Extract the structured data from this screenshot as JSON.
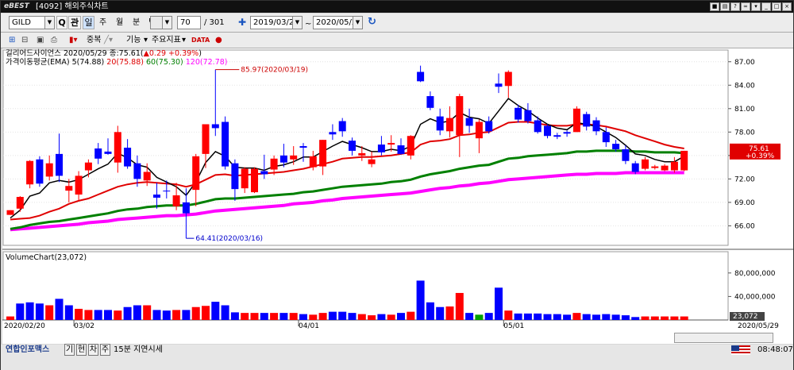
{
  "titlebar": {
    "logo": "eBEST",
    "title": "[4092] 해외주식차트"
  },
  "toolbar": {
    "symbol": "GILD",
    "search_label": "Q",
    "mode_label": "관",
    "periods": [
      "일",
      "주",
      "월",
      "분",
      "틱"
    ],
    "count": "70",
    "total": "/ 301",
    "start_date": "2019/03/21",
    "end_date": "2020/05/29",
    "range_sep": "~"
  },
  "toolbar2": {
    "overlap_label": "중복",
    "function_label": "기능",
    "indicator_label": "주요지표"
  },
  "legend": {
    "name": "길리어드사이언스",
    "info": "2020/05/29 종:75.61(",
    "change": "▲0.29 +0.39%",
    "close_paren": ")",
    "ema_label": "가격이동평균(EMA)",
    "ema5": "5(74.88)",
    "ema20": "20(75.88)",
    "ema60": "60(75.30)",
    "ema120": "120(72.78)",
    "volume_label": "VolumeChart(23,072)"
  },
  "annotations": {
    "high": "85.97(2020/03/19)",
    "low": "64.41(2020/03/16)"
  },
  "price_badge": {
    "price": "75.61",
    "pct": "+0.39%"
  },
  "volume_badge": "23,072",
  "status": {
    "news": "연합인포맥스",
    "tabs": [
      "기",
      "현",
      "차",
      "주"
    ],
    "delay": "15분 지연시세",
    "time": "08:48:07"
  },
  "chart_data": [
    {
      "type": "candlestick",
      "ylim": [
        63.5,
        88.5
      ],
      "y_ticks": [
        66,
        69,
        72,
        75,
        78,
        81,
        84,
        87
      ],
      "y_tick_labels": [
        "66.00",
        "69.00",
        "72.00",
        "75.00",
        "78.00",
        "81.00",
        "84.00",
        "87.00"
      ],
      "x_tick_labels": [
        {
          "i": 0,
          "label": "2020/02/20"
        },
        {
          "i": 7,
          "label": "03/02"
        },
        {
          "i": 30,
          "label": "04/01"
        },
        {
          "i": 51,
          "label": "05/01"
        },
        {
          "i": 69,
          "label": "2020/05/29"
        }
      ],
      "candles": [
        [
          67.4,
          68.0,
          67.4,
          68.0
        ],
        [
          68.2,
          69.8,
          67.8,
          69.7
        ],
        [
          71.3,
          74.4,
          70.8,
          74.3
        ],
        [
          74.5,
          74.9,
          71.0,
          71.4
        ],
        [
          72.3,
          75.0,
          71.8,
          74.0
        ],
        [
          75.2,
          77.8,
          71.6,
          72.4
        ],
        [
          70.5,
          72.0,
          69.0,
          71.1
        ],
        [
          70.0,
          73.0,
          69.3,
          72.4
        ],
        [
          73.1,
          74.5,
          72.2,
          74.1
        ],
        [
          75.9,
          76.6,
          73.9,
          74.6
        ],
        [
          75.5,
          77.2,
          75.1,
          75.2
        ],
        [
          74.1,
          78.8,
          72.8,
          78.0
        ],
        [
          76.0,
          77.1,
          73.3,
          73.6
        ],
        [
          74.0,
          75.0,
          71.0,
          72.0
        ],
        [
          71.8,
          74.0,
          71.1,
          72.9
        ],
        [
          70.0,
          71.5,
          68.2,
          69.6
        ],
        [
          70.5,
          71.8,
          69.5,
          70.4
        ],
        [
          68.5,
          71.5,
          68.0,
          69.9
        ],
        [
          69.0,
          70.8,
          64.4,
          67.6
        ],
        [
          70.6,
          75.2,
          68.5,
          74.9
        ],
        [
          75.2,
          79.0,
          73.4,
          79.0
        ],
        [
          79.0,
          86.0,
          77.5,
          78.5
        ],
        [
          79.3,
          80.0,
          73.2,
          73.6
        ],
        [
          74.0,
          74.5,
          69.2,
          70.7
        ],
        [
          70.8,
          73.5,
          70.2,
          73.3
        ],
        [
          70.3,
          73.5,
          70.2,
          73.3
        ],
        [
          73.0,
          75.1,
          72.0,
          72.6
        ],
        [
          73.2,
          75.0,
          72.5,
          74.6
        ],
        [
          75.0,
          76.5,
          73.5,
          74.1
        ],
        [
          74.5,
          76.2,
          73.8,
          75.0
        ],
        [
          76.2,
          76.6,
          74.2,
          76.0
        ],
        [
          73.5,
          75.6,
          73.1,
          74.9
        ],
        [
          73.6,
          77.0,
          72.5,
          77.0
        ],
        [
          78.0,
          79.0,
          77.0,
          77.7
        ],
        [
          79.4,
          79.8,
          77.4,
          78.1
        ],
        [
          76.9,
          77.3,
          75.0,
          75.6
        ],
        [
          75.0,
          76.2,
          74.3,
          75.3
        ],
        [
          73.9,
          75.5,
          73.5,
          74.5
        ],
        [
          76.4,
          77.5,
          75.0,
          75.4
        ],
        [
          76.4,
          77.6,
          75.5,
          76.6
        ],
        [
          76.3,
          77.2,
          75.1,
          75.2
        ],
        [
          75.0,
          77.6,
          74.5,
          77.5
        ],
        [
          85.7,
          86.5,
          84.4,
          84.5
        ],
        [
          82.6,
          83.2,
          80.8,
          81.1
        ],
        [
          80.0,
          81.0,
          77.6,
          78.2
        ],
        [
          78.1,
          81.3,
          77.3,
          79.8
        ],
        [
          77.6,
          82.9,
          74.8,
          82.6
        ],
        [
          79.8,
          81.0,
          77.9,
          78.8
        ],
        [
          77.2,
          79.6,
          75.3,
          79.3
        ],
        [
          79.4,
          80.0,
          77.8,
          78.1
        ],
        [
          84.2,
          85.5,
          83.0,
          83.8
        ],
        [
          83.9,
          85.9,
          82.4,
          85.7
        ],
        [
          81.1,
          81.5,
          79.2,
          79.6
        ],
        [
          80.8,
          81.7,
          79.1,
          79.4
        ],
        [
          79.5,
          80.0,
          77.8,
          78.0
        ],
        [
          78.8,
          79.0,
          77.2,
          77.5
        ],
        [
          77.6,
          77.9,
          77.1,
          77.4
        ],
        [
          78.0,
          78.2,
          77.4,
          77.8
        ],
        [
          78.0,
          81.3,
          78.0,
          81.0
        ],
        [
          80.3,
          80.6,
          78.2,
          78.7
        ],
        [
          79.5,
          79.9,
          77.6,
          78.1
        ],
        [
          78.0,
          78.6,
          76.1,
          76.7
        ],
        [
          76.5,
          77.0,
          75.5,
          75.8
        ],
        [
          75.8,
          76.3,
          73.9,
          74.3
        ],
        [
          74.0,
          74.3,
          72.6,
          72.9
        ],
        [
          73.3,
          74.8,
          73.1,
          74.5
        ],
        [
          73.4,
          73.8,
          73.2,
          73.6
        ],
        [
          73.1,
          73.9,
          73.0,
          73.7
        ],
        [
          73.1,
          74.8,
          72.8,
          74.2
        ],
        [
          73.1,
          75.6,
          73.0,
          75.6
        ]
      ],
      "ema5": [
        67.0,
        68.0,
        69.8,
        70.2,
        71.5,
        71.8,
        71.6,
        71.9,
        72.6,
        73.3,
        73.9,
        75.3,
        74.7,
        73.8,
        73.5,
        72.2,
        71.6,
        71.0,
        69.9,
        71.6,
        74.1,
        75.5,
        74.9,
        73.5,
        73.4,
        73.4,
        73.1,
        73.6,
        73.8,
        74.2,
        74.8,
        74.8,
        75.5,
        76.2,
        76.8,
        76.4,
        76.0,
        75.5,
        75.5,
        75.8,
        75.6,
        76.2,
        79.0,
        79.7,
        79.2,
        79.4,
        80.5,
        79.9,
        79.7,
        79.1,
        80.7,
        82.3,
        81.4,
        80.7,
        79.8,
        79.0,
        78.5,
        78.3,
        79.2,
        79.0,
        78.7,
        78.0,
        77.3,
        76.3,
        75.2,
        75.0,
        74.5,
        74.2,
        74.2,
        74.9
      ],
      "ema20": [
        66.8,
        66.9,
        67.0,
        67.3,
        67.8,
        68.2,
        68.8,
        69.2,
        69.5,
        70.0,
        70.5,
        71.0,
        71.3,
        71.5,
        71.6,
        71.5,
        71.4,
        71.3,
        71.0,
        71.3,
        71.9,
        72.5,
        72.6,
        72.4,
        72.5,
        72.6,
        72.7,
        72.8,
        72.9,
        73.1,
        73.3,
        73.6,
        73.9,
        74.2,
        74.6,
        74.7,
        74.8,
        74.8,
        74.9,
        75.0,
        75.2,
        75.4,
        76.4,
        76.8,
        76.9,
        77.1,
        77.6,
        77.7,
        77.9,
        78.0,
        78.6,
        79.2,
        79.3,
        79.3,
        79.1,
        78.9,
        78.8,
        78.8,
        79.0,
        79.0,
        78.9,
        78.7,
        78.4,
        78.1,
        77.6,
        77.2,
        76.8,
        76.4,
        76.1,
        75.9
      ],
      "ema60": [
        65.6,
        65.8,
        66.1,
        66.3,
        66.5,
        66.6,
        66.8,
        67.0,
        67.2,
        67.4,
        67.6,
        67.9,
        68.1,
        68.2,
        68.4,
        68.5,
        68.6,
        68.6,
        68.6,
        68.8,
        69.1,
        69.4,
        69.5,
        69.5,
        69.6,
        69.7,
        69.8,
        69.9,
        70.0,
        70.1,
        70.3,
        70.4,
        70.6,
        70.8,
        71.0,
        71.1,
        71.2,
        71.3,
        71.4,
        71.6,
        71.7,
        71.9,
        72.3,
        72.6,
        72.8,
        73.0,
        73.3,
        73.5,
        73.7,
        73.8,
        74.2,
        74.6,
        74.7,
        74.9,
        75.0,
        75.1,
        75.2,
        75.3,
        75.5,
        75.5,
        75.6,
        75.6,
        75.6,
        75.6,
        75.5,
        75.5,
        75.4,
        75.4,
        75.4,
        75.3
      ],
      "ema120": [
        65.5,
        65.6,
        65.7,
        65.8,
        65.9,
        66.0,
        66.1,
        66.2,
        66.4,
        66.5,
        66.6,
        66.8,
        66.9,
        67.0,
        67.1,
        67.2,
        67.3,
        67.3,
        67.4,
        67.5,
        67.7,
        67.9,
        68.0,
        68.1,
        68.2,
        68.3,
        68.4,
        68.5,
        68.6,
        68.8,
        68.9,
        69.0,
        69.2,
        69.3,
        69.5,
        69.6,
        69.7,
        69.8,
        69.9,
        70.0,
        70.1,
        70.2,
        70.4,
        70.6,
        70.8,
        70.9,
        71.1,
        71.2,
        71.4,
        71.5,
        71.7,
        71.9,
        72.0,
        72.1,
        72.2,
        72.3,
        72.4,
        72.5,
        72.6,
        72.6,
        72.7,
        72.7,
        72.7,
        72.8,
        72.8,
        72.8,
        72.8,
        72.8,
        72.8,
        72.8
      ]
    },
    {
      "type": "bar",
      "title": "VolumeChart",
      "ylim": [
        0,
        100000000
      ],
      "y_tick_labels": [
        "40,000,000",
        "80,000,000"
      ],
      "values": [
        6,
        28,
        30,
        28,
        25,
        36,
        25,
        19,
        17,
        17,
        17,
        16,
        22,
        25,
        25,
        17,
        16,
        17,
        17,
        22,
        24,
        31,
        25,
        13,
        12,
        12,
        12,
        12,
        12,
        12,
        10,
        9,
        12,
        14,
        14,
        12,
        10,
        8,
        10,
        9,
        12,
        14,
        67,
        30,
        22,
        23,
        46,
        12,
        9,
        12,
        55,
        16,
        11,
        11,
        11,
        10,
        10,
        9,
        12,
        10,
        9,
        10,
        9,
        8,
        5,
        6,
        6,
        6,
        6,
        6
      ],
      "colors": [
        "up",
        "down",
        "down",
        "down",
        "up",
        "down",
        "down",
        "up",
        "up",
        "down",
        "down",
        "up",
        "down",
        "down",
        "up",
        "down",
        "down",
        "up",
        "down",
        "up",
        "up",
        "down",
        "down",
        "down",
        "up",
        "up",
        "down",
        "up",
        "down",
        "up",
        "down",
        "up",
        "up",
        "down",
        "down",
        "down",
        "up",
        "up",
        "down",
        "up",
        "down",
        "up",
        "down",
        "down",
        "down",
        "up",
        "up",
        "down",
        "green",
        "down",
        "down",
        "up",
        "down",
        "down",
        "down",
        "down",
        "down",
        "down",
        "up",
        "down",
        "down",
        "down",
        "down",
        "down",
        "down",
        "up",
        "up",
        "up",
        "up",
        "up"
      ]
    }
  ],
  "colors": {
    "up": "#ff0000",
    "down": "#0000ff",
    "ema5": "#000000",
    "ema20": "#e00000",
    "ema60": "#008000",
    "ema120": "#ff00ff",
    "badge": "#e00000"
  }
}
